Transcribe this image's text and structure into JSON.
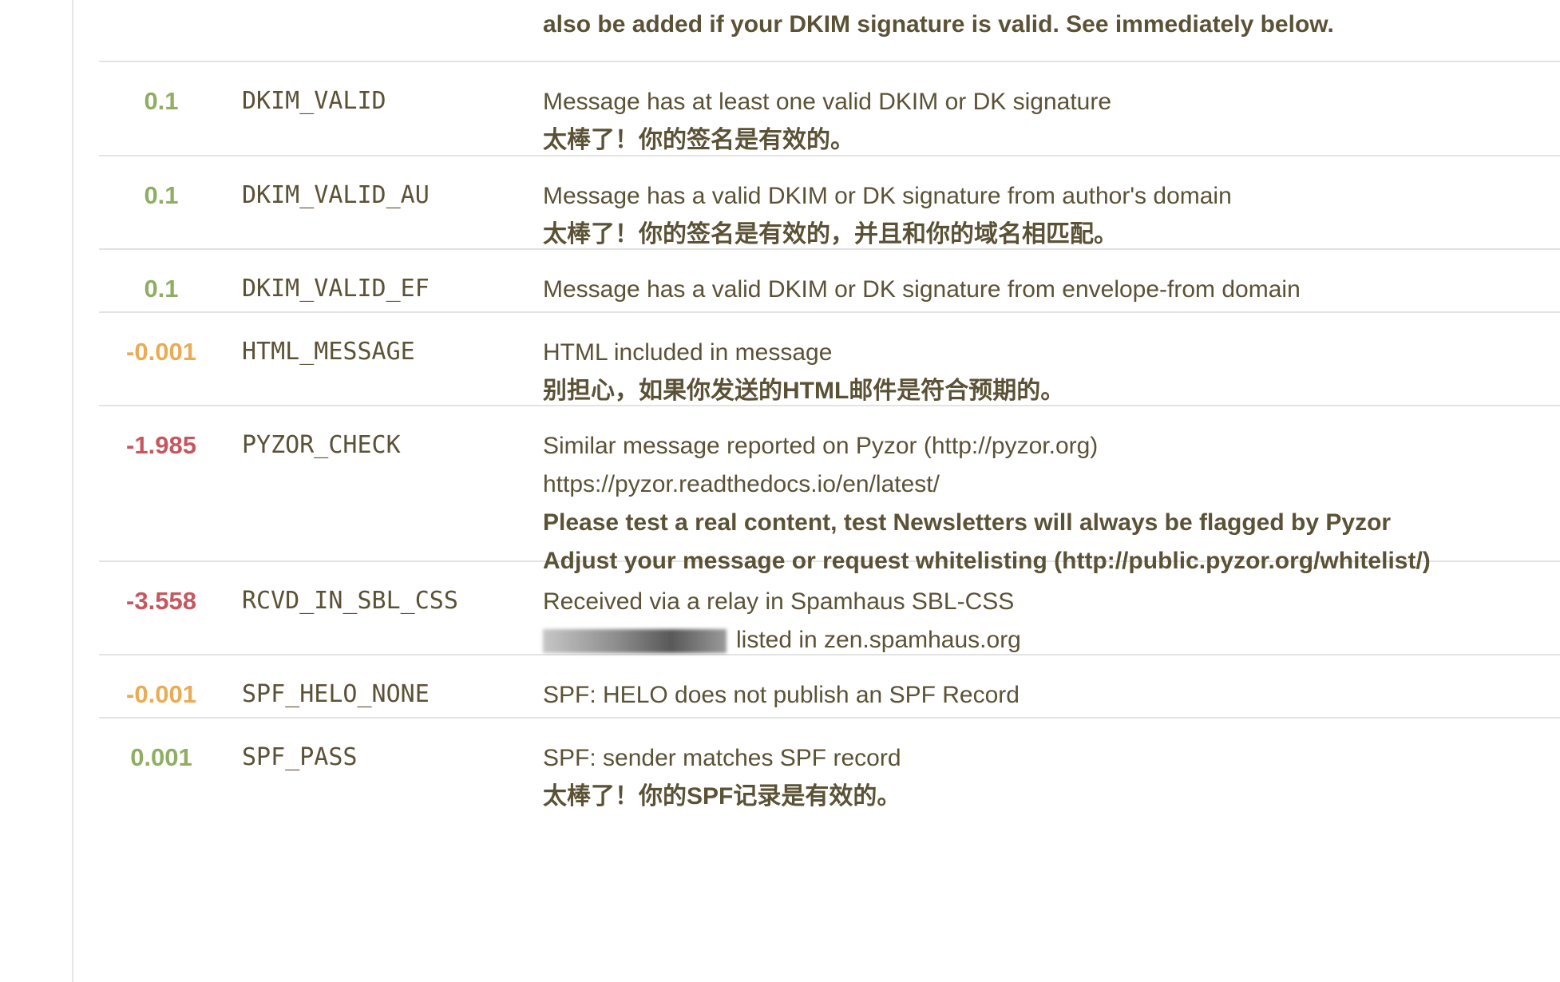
{
  "intro": {
    "text": "also be added if your DKIM signature is valid. See immediately below."
  },
  "rows": [
    {
      "score": "0.1",
      "level": "good",
      "rule": "DKIM_VALID",
      "lines": [
        {
          "text": "Message has at least one valid DKIM or DK signature",
          "bold": false
        },
        {
          "text": "太棒了！你的签名是有效的。",
          "bold": true
        }
      ]
    },
    {
      "score": "0.1",
      "level": "good",
      "rule": "DKIM_VALID_AU",
      "lines": [
        {
          "text": "Message has a valid DKIM or DK signature from author's domain",
          "bold": false
        },
        {
          "text": "太棒了！你的签名是有效的，并且和你的域名相匹配。",
          "bold": true
        }
      ]
    },
    {
      "score": "0.1",
      "level": "good",
      "rule": "DKIM_VALID_EF",
      "lines": [
        {
          "text": "Message has a valid DKIM or DK signature from envelope-from domain",
          "bold": false
        }
      ]
    },
    {
      "score": "-0.001",
      "level": "warn",
      "rule": "HTML_MESSAGE",
      "lines": [
        {
          "text": "HTML included in message",
          "bold": false
        },
        {
          "text": "别担心，如果你发送的HTML邮件是符合预期的。",
          "bold": true
        }
      ]
    },
    {
      "score": "-1.985",
      "level": "bad",
      "rule": "PYZOR_CHECK",
      "lines": [
        {
          "text": "Similar message reported on Pyzor (http://pyzor.org)",
          "bold": false
        },
        {
          "text": "https://pyzor.readthedocs.io/en/latest/",
          "bold": false
        },
        {
          "text": "Please test a real content, test Newsletters will always be flagged by Pyzor",
          "bold": true
        },
        {
          "text": "Adjust your message or request whitelisting (http://public.pyzor.org/whitelist/)",
          "bold": true
        }
      ]
    },
    {
      "score": "-3.558",
      "level": "bad",
      "rule": "RCVD_IN_SBL_CSS",
      "lines": [
        {
          "text": "Received via a relay in Spamhaus SBL-CSS",
          "bold": false
        },
        {
          "text": "listed in zen.spamhaus.org",
          "bold": false,
          "redacted_prefix": true
        }
      ]
    },
    {
      "score": "-0.001",
      "level": "warn",
      "rule": "SPF_HELO_NONE",
      "lines": [
        {
          "text": "SPF: HELO does not publish an SPF Record",
          "bold": false
        }
      ]
    },
    {
      "score": "0.001",
      "level": "good",
      "rule": "SPF_PASS",
      "lines": [
        {
          "text": "SPF: sender matches SPF record",
          "bold": false
        },
        {
          "text": "太棒了！你的SPF记录是有效的。",
          "bold": true
        }
      ]
    }
  ],
  "colors": {
    "good": "#8fae63",
    "warn": "#e9ac55",
    "bad": "#c7575f",
    "text": "#5b5236",
    "divider": "#e3e3e3"
  }
}
